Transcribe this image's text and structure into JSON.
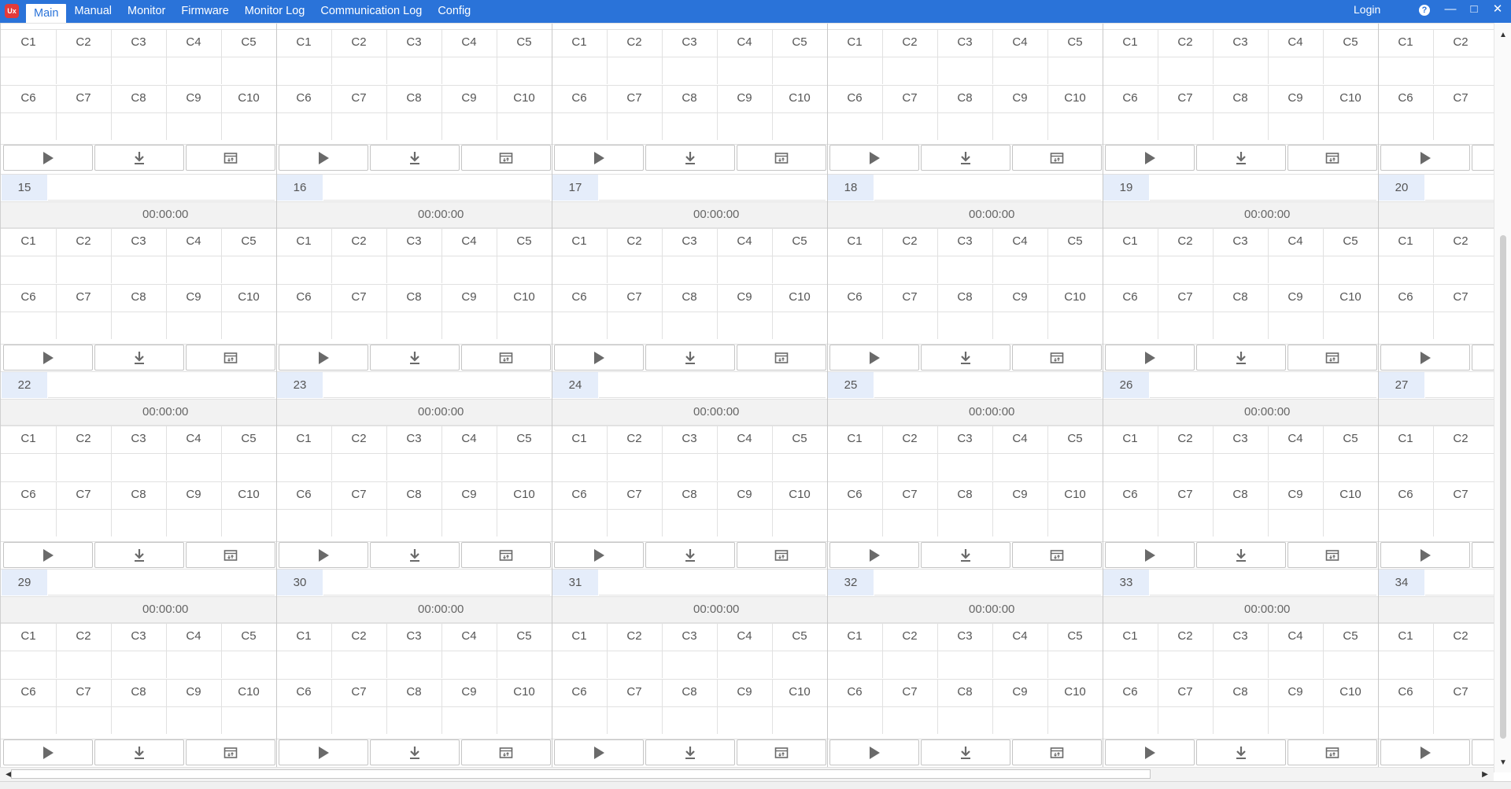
{
  "app": {
    "logo_text": "Ux"
  },
  "menu": [
    {
      "label": "Main",
      "active": true
    },
    {
      "label": "Manual"
    },
    {
      "label": "Monitor"
    },
    {
      "label": "Firmware"
    },
    {
      "label": "Monitor Log"
    },
    {
      "label": "Communication Log"
    },
    {
      "label": "Config"
    }
  ],
  "header": {
    "login": "Login",
    "help": "?"
  },
  "grid": {
    "top_labels": [
      "C1",
      "C2",
      "C3",
      "C4",
      "C5"
    ],
    "bottom_labels": [
      "C6",
      "C7",
      "C8",
      "C9",
      "C10"
    ],
    "partial_top": [
      "C1",
      "C2"
    ],
    "partial_bottom": [
      "C6",
      "C7"
    ],
    "default_time": "00:00:00",
    "unit_rows": [
      [
        "15",
        "16",
        "17",
        "18",
        "19",
        "20"
      ],
      [
        "22",
        "23",
        "24",
        "25",
        "26",
        "27"
      ],
      [
        "29",
        "30",
        "31",
        "32",
        "33",
        "34"
      ]
    ],
    "buttons": [
      {
        "icon": "play-icon",
        "name": "start-button"
      },
      {
        "icon": "download-icon",
        "name": "download-button"
      },
      {
        "icon": "settings-icon",
        "name": "settings-button"
      }
    ]
  }
}
